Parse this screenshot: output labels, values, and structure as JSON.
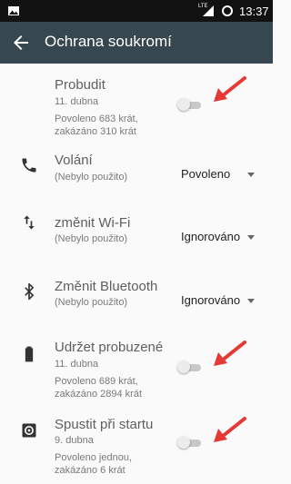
{
  "status_bar": {
    "network": "LTE",
    "time": "13:37",
    "left_icon": "image-icon",
    "signal_icon": "signal-icon",
    "indicator_icon": "circle-icon"
  },
  "app_bar": {
    "title": "Ochrana soukromí",
    "back_icon": "arrow-back-icon",
    "background": "#37474f"
  },
  "permissions": [
    {
      "title": "Probudit",
      "date": "11. dubna",
      "allowed": "Povoleno 683 krát,",
      "denied": "zakázáno 310 krát",
      "control": "toggle",
      "enabled": false
    },
    {
      "title": "Volání",
      "status": "(Nebylo použito)",
      "icon": "phone-icon",
      "control": "dropdown",
      "value": "Povoleno"
    },
    {
      "title": "změnit Wi-Fi",
      "status": "(Nebylo použito)",
      "icon": "swap-vertical-icon",
      "control": "dropdown",
      "value": "Ignorováno"
    },
    {
      "title": "Změnit Bluetooth",
      "status": "(Nebylo použito)",
      "icon": "bluetooth-icon",
      "control": "dropdown",
      "value": "Ignorováno"
    },
    {
      "title": "Udržet probuzené",
      "date": "11. dubna",
      "allowed": "Povoleno 689 krát,",
      "denied": "zakázáno 2894 krát",
      "icon": "battery-icon",
      "control": "toggle",
      "enabled": false
    },
    {
      "title": "Spustit při startu",
      "date": "9. dubna",
      "allowed": "Povoleno jednou,",
      "denied": "zakázáno 6 krát",
      "icon": "settings-icon",
      "control": "toggle",
      "enabled": false
    }
  ],
  "annotation_color": "#e53935"
}
